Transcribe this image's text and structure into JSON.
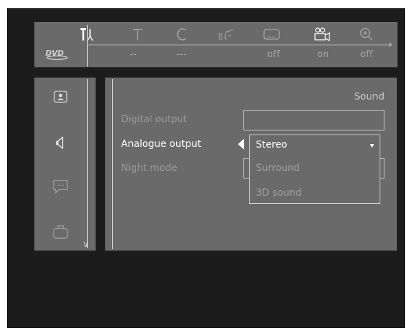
{
  "topbar": {
    "values": [
      "--",
      "---",
      "off",
      "on",
      "off"
    ],
    "icons": [
      "setup-icon",
      "title-icon",
      "chapter-icon",
      "audio-icon",
      "subtitle-icon",
      "angle-icon",
      "zoom-icon"
    ],
    "logo_text": "DVD"
  },
  "sidebar": {
    "icons": [
      "picture-settings-icon",
      "sound-settings-icon",
      "language-settings-icon",
      "features-settings-icon"
    ]
  },
  "main": {
    "section_title": "Sound",
    "rows": [
      {
        "label": "Digital output"
      },
      {
        "label": "Analogue output"
      },
      {
        "label": "Night mode"
      }
    ],
    "dropdown": {
      "options": [
        "Stereo",
        "Surround",
        "3D sound"
      ],
      "selected": "Stereo"
    }
  },
  "colors": {
    "screen_bg": "#1c1c1c",
    "panel_bg": "#6a6a6a",
    "highlight": "#ffffff",
    "dim_text": "#9a9a9a"
  }
}
